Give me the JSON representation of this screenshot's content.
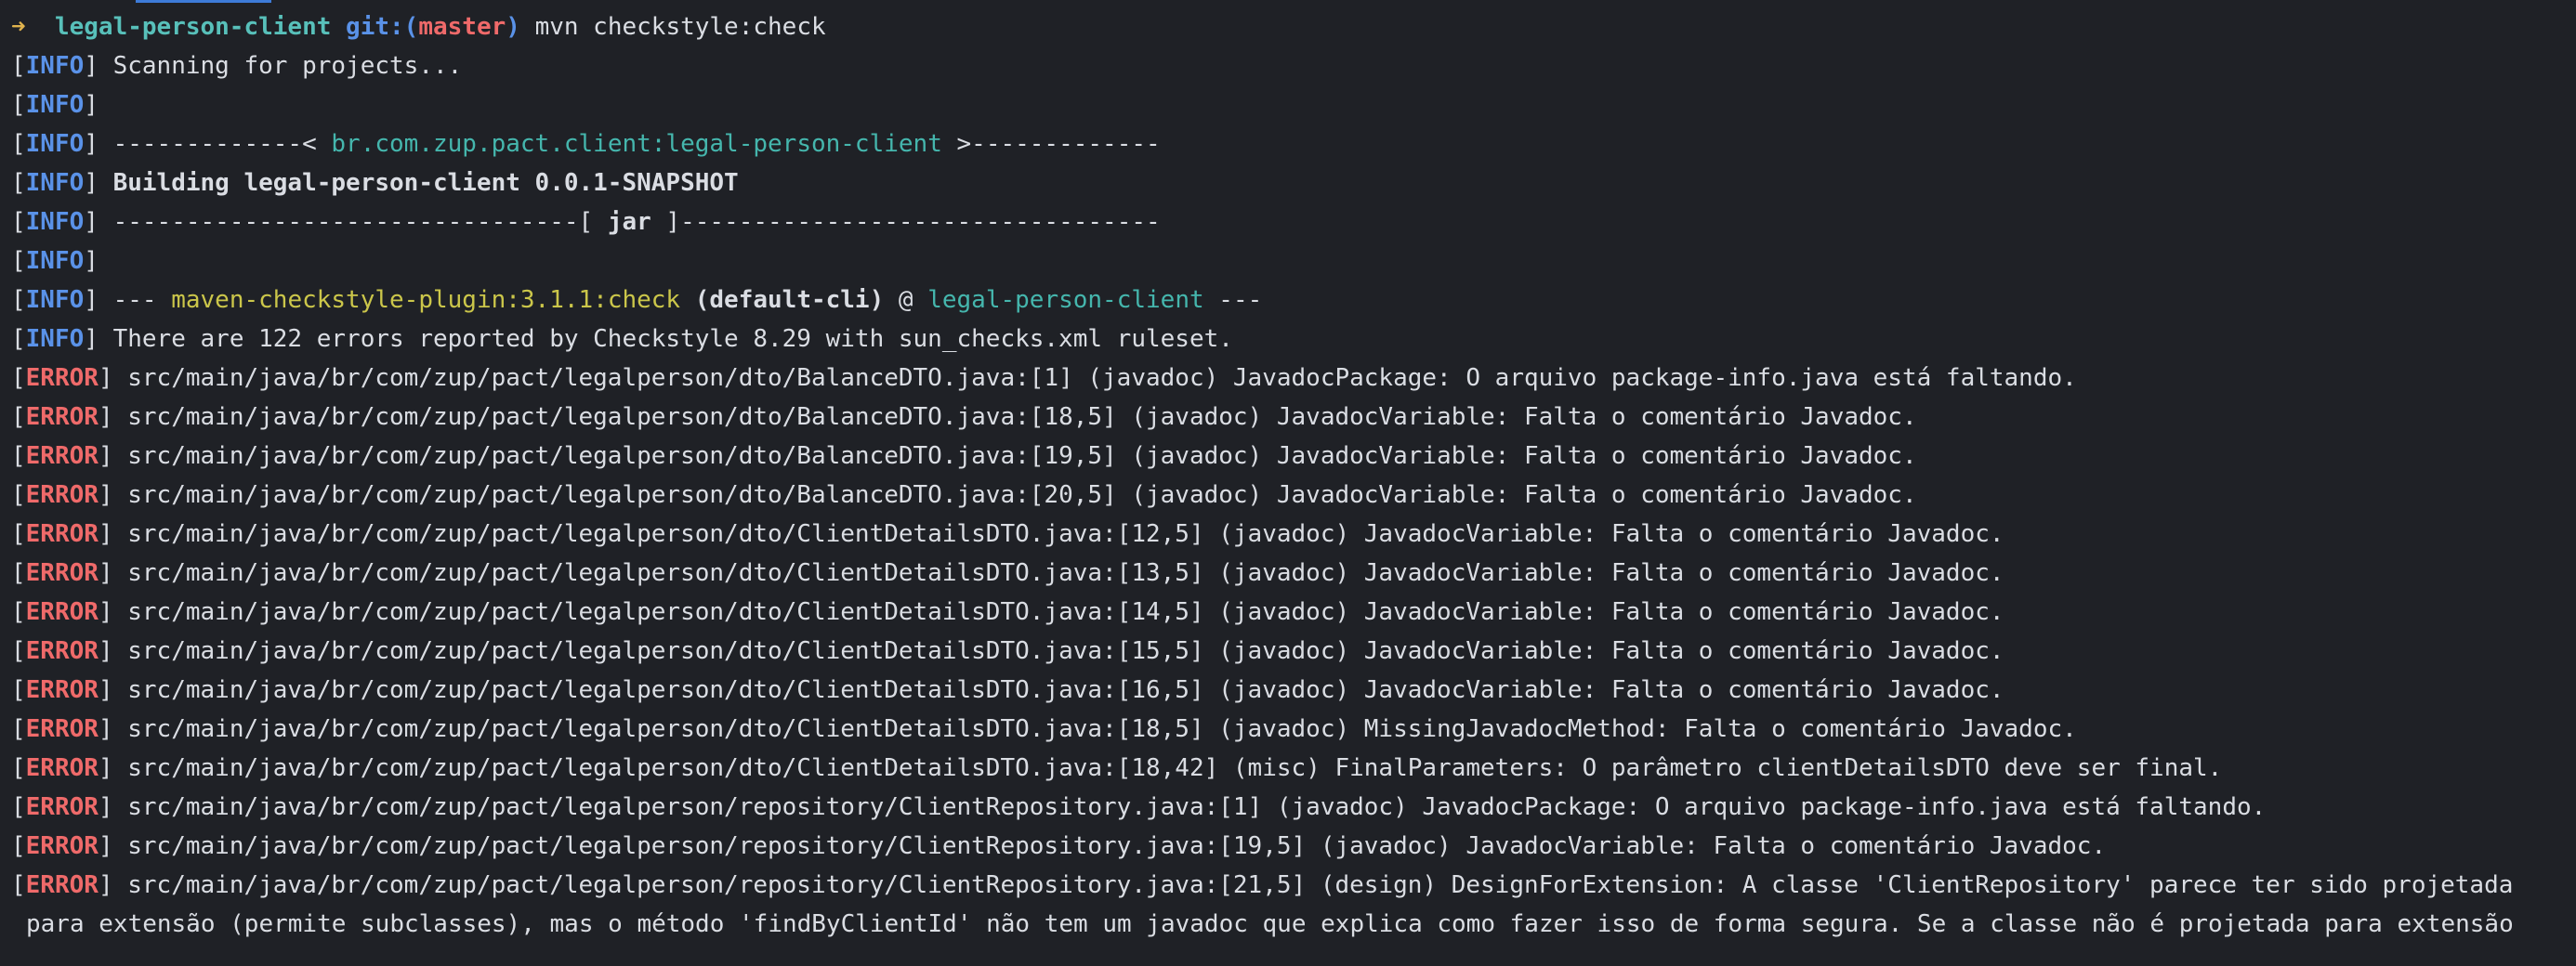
{
  "prompt": {
    "arrow": "➜",
    "directory": "legal-person-client",
    "git_prefix": "git:(",
    "branch": "master",
    "git_suffix": ")",
    "command": "mvn checkstyle:check"
  },
  "tags": {
    "info": "INFO",
    "error": "ERROR",
    "open": "[",
    "close": "]"
  },
  "output": {
    "scanning": "Scanning for projects...",
    "artifact_prefix": "-------------< ",
    "artifact": "br.com.zup.pact.client:legal-person-client",
    "artifact_suffix": " >-------------",
    "building": "Building legal-person-client 0.0.1-SNAPSHOT",
    "jar_prefix": "--------------------------------[ ",
    "jar": "jar",
    "jar_suffix": " ]---------------------------------",
    "plugin_prefix": "--- ",
    "plugin": "maven-checkstyle-plugin:3.1.1:check",
    "plugin_exec": " (default-cli)",
    "plugin_at": " @ ",
    "plugin_project": "legal-person-client",
    "plugin_suffix": " ---",
    "summary": "There are 122 errors reported by Checkstyle 8.29 with sun_checks.xml ruleset."
  },
  "errors": [
    "src/main/java/br/com/zup/pact/legalperson/dto/BalanceDTO.java:[1] (javadoc) JavadocPackage: O arquivo package-info.java está faltando.",
    "src/main/java/br/com/zup/pact/legalperson/dto/BalanceDTO.java:[18,5] (javadoc) JavadocVariable: Falta o comentário Javadoc.",
    "src/main/java/br/com/zup/pact/legalperson/dto/BalanceDTO.java:[19,5] (javadoc) JavadocVariable: Falta o comentário Javadoc.",
    "src/main/java/br/com/zup/pact/legalperson/dto/BalanceDTO.java:[20,5] (javadoc) JavadocVariable: Falta o comentário Javadoc.",
    "src/main/java/br/com/zup/pact/legalperson/dto/ClientDetailsDTO.java:[12,5] (javadoc) JavadocVariable: Falta o comentário Javadoc.",
    "src/main/java/br/com/zup/pact/legalperson/dto/ClientDetailsDTO.java:[13,5] (javadoc) JavadocVariable: Falta o comentário Javadoc.",
    "src/main/java/br/com/zup/pact/legalperson/dto/ClientDetailsDTO.java:[14,5] (javadoc) JavadocVariable: Falta o comentário Javadoc.",
    "src/main/java/br/com/zup/pact/legalperson/dto/ClientDetailsDTO.java:[15,5] (javadoc) JavadocVariable: Falta o comentário Javadoc.",
    "src/main/java/br/com/zup/pact/legalperson/dto/ClientDetailsDTO.java:[16,5] (javadoc) JavadocVariable: Falta o comentário Javadoc.",
    "src/main/java/br/com/zup/pact/legalperson/dto/ClientDetailsDTO.java:[18,5] (javadoc) MissingJavadocMethod: Falta o comentário Javadoc.",
    "src/main/java/br/com/zup/pact/legalperson/dto/ClientDetailsDTO.java:[18,42] (misc) FinalParameters: O parâmetro clientDetailsDTO deve ser final.",
    "src/main/java/br/com/zup/pact/legalperson/repository/ClientRepository.java:[1] (javadoc) JavadocPackage: O arquivo package-info.java está faltando.",
    "src/main/java/br/com/zup/pact/legalperson/repository/ClientRepository.java:[19,5] (javadoc) JavadocVariable: Falta o comentário Javadoc.",
    "src/main/java/br/com/zup/pact/legalperson/repository/ClientRepository.java:[21,5] (design) DesignForExtension: A classe 'ClientRepository' parece ter sido projetada"
  ],
  "continuation": "para extensão (permite subclasses), mas o método 'findByClientId' não tem um javadoc que explica como fazer isso de forma segura. Se a classe não é projetada para extensão",
  "colors": {
    "background": "#1f2126",
    "text": "#dadde3",
    "info_tag": "#5a92e8",
    "error_tag": "#ef6a6a",
    "directory": "#58c0ba",
    "artifact": "#45b6ad",
    "plugin": "#cbc64a",
    "prompt_arrow": "#e0b34d",
    "active_tab": "#3d7bd8"
  }
}
